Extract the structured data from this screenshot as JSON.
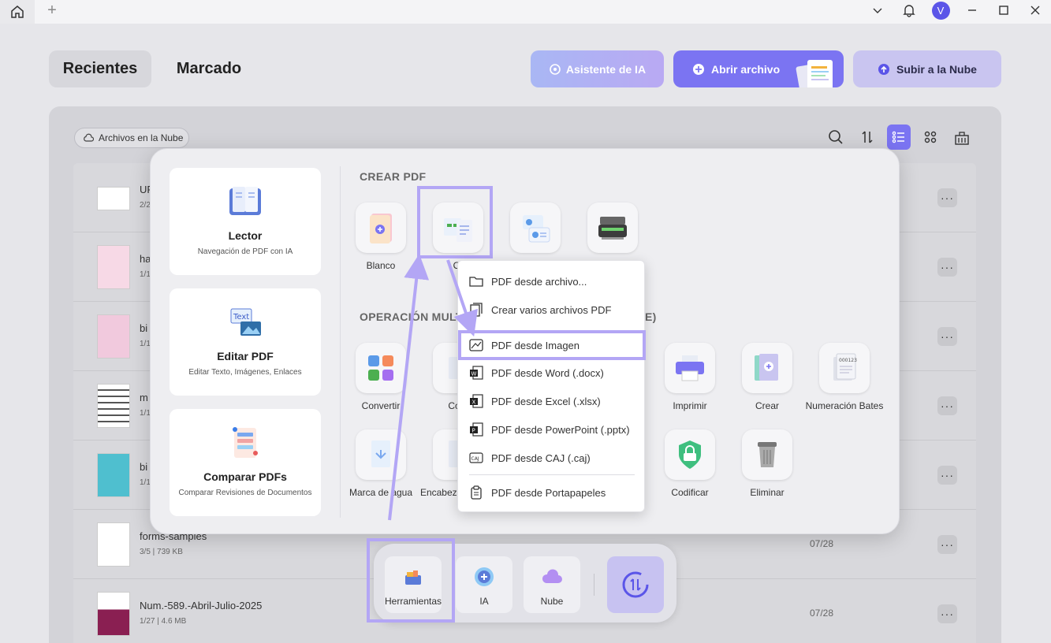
{
  "titlebar": {
    "avatar_letter": "V",
    "icons": [
      "home-icon",
      "plus-icon",
      "chevron-down-icon",
      "bell-icon",
      "minimize-icon",
      "maximize-icon",
      "close-icon"
    ]
  },
  "header": {
    "tab_recent": "Recientes",
    "tab_marked": "Marcado",
    "btn_ai": "Asistente de IA",
    "btn_open": "Abrir archivo",
    "btn_cloud": "Subir a la Nube"
  },
  "toolbar": {
    "cloud_chip": "Archivos en la Nube"
  },
  "files": [
    {
      "name": "UP",
      "meta": "2/2"
    },
    {
      "name": "ha",
      "meta": "1/1"
    },
    {
      "name": "bi",
      "meta": "1/1"
    },
    {
      "name": "m",
      "meta": "1/1"
    },
    {
      "name": "bi",
      "meta": "1/1"
    },
    {
      "name": "forms-samples",
      "meta": "3/5 | 739 KB",
      "date": "07/28"
    },
    {
      "name": "Num.-589.-Abril-Julio-2025",
      "meta": "1/27 | 4.6 MB",
      "date": "07/28"
    }
  ],
  "more_label": "···",
  "popup": {
    "cards": [
      {
        "title": "Lector",
        "subtitle": "Navegación de PDF con IA"
      },
      {
        "title": "Editar PDF",
        "subtitle": "Editar Texto, Imágenes, Enlaces"
      },
      {
        "title": "Comparar PDFs",
        "subtitle": "Comparar Revisiones de Documentos"
      }
    ],
    "section_create": "CREAR PDF",
    "section_multi_a": "OPERACIÓN MULT",
    "section_multi_b": "E)",
    "create_tools": [
      {
        "label": "Blanco"
      },
      {
        "label": "Ot"
      },
      {
        "label": ""
      },
      {
        "label": ""
      }
    ],
    "multi_tools_row1": [
      {
        "label": "Convertir"
      },
      {
        "label": "Com"
      },
      {
        "label": "Imprimir"
      },
      {
        "label": "Crear"
      },
      {
        "label": "Numeración Bates"
      }
    ],
    "multi_tools_row2": [
      {
        "label": "Marca de agua"
      },
      {
        "label": "Encabezados de pá"
      },
      {
        "label": "Codificar"
      },
      {
        "label": "Eliminar"
      }
    ]
  },
  "dropdown": {
    "items": [
      {
        "label": "PDF desde archivo...",
        "icon": "folder-icon"
      },
      {
        "label": "Crear varios archivos PDF",
        "icon": "files-icon"
      },
      {
        "label": "PDF desde Imagen",
        "icon": "image-icon"
      },
      {
        "label": "PDF desde Word (.docx)",
        "icon": "word-icon"
      },
      {
        "label": "PDF desde Excel (.xlsx)",
        "icon": "excel-icon"
      },
      {
        "label": "PDF desde PowerPoint (.pptx)",
        "icon": "powerpoint-icon"
      },
      {
        "label": "PDF desde CAJ (.caj)",
        "icon": "caj-icon"
      },
      {
        "label": "PDF desde Portapapeles",
        "icon": "clipboard-icon"
      }
    ]
  },
  "dock": {
    "tools": "Herramientas",
    "ai": "IA",
    "cloud": "Nube"
  },
  "colors": {
    "accent": "#7b74f2",
    "highlight": "#b3a6f5"
  }
}
